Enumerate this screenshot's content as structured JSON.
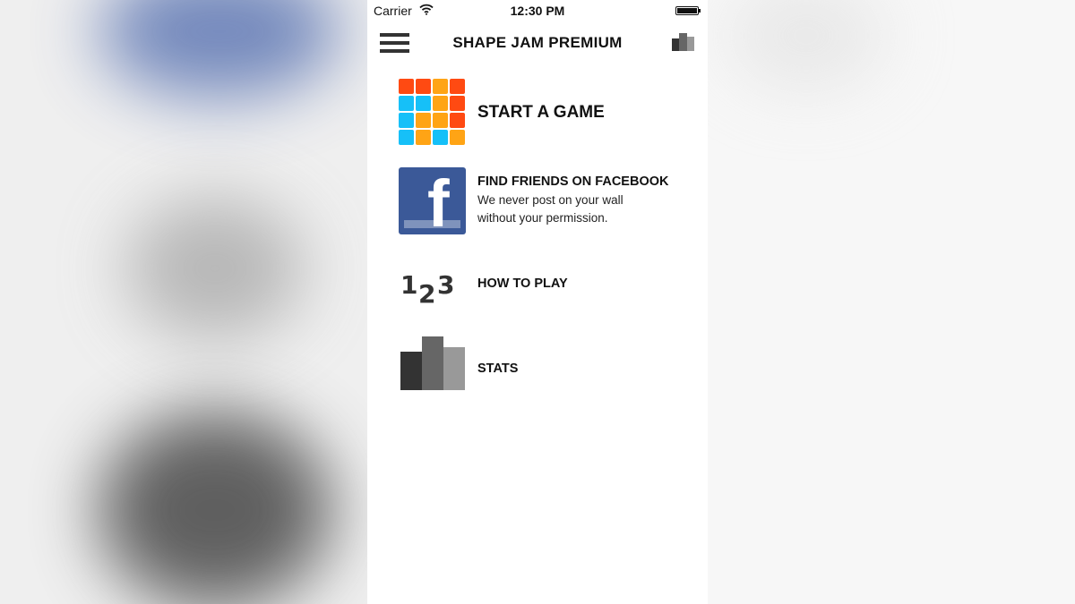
{
  "status_bar": {
    "carrier": "Carrier",
    "time": "12:30 PM"
  },
  "nav": {
    "title": "SHAPE JAM PREMIUM"
  },
  "menu": {
    "start_game": {
      "title": "START A GAME",
      "icon": "colored-grid-icon"
    },
    "facebook": {
      "title": "FIND FRIENDS ON FACEBOOK",
      "subtitle_line1": "We never post on your wall",
      "subtitle_line2": "without your permission.",
      "icon": "facebook-icon"
    },
    "how_to_play": {
      "title": "HOW TO PLAY",
      "icon": "numbers-123-icon"
    },
    "stats": {
      "title": "STATS",
      "icon": "bar-chart-icon"
    }
  },
  "colors": {
    "red": "#ff4a12",
    "orange": "#ffa415",
    "blue": "#16c0f8",
    "facebook": "#3b5998",
    "bar_dark": "#333333",
    "bar_mid": "#666666",
    "bar_light": "#999999"
  }
}
